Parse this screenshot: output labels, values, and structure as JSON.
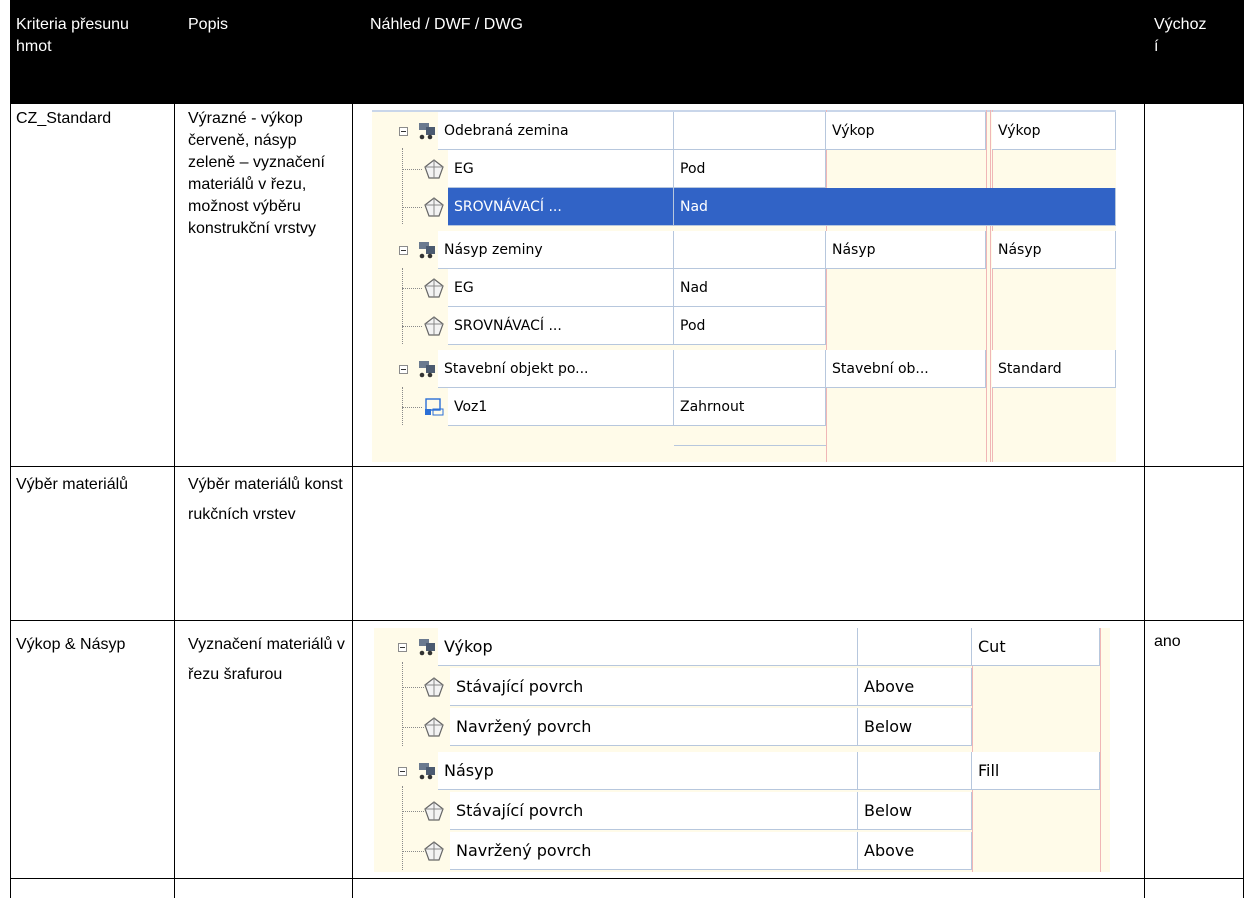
{
  "table": {
    "headers": {
      "criteria": "Kriteria přesunu hmot",
      "description": "Popis",
      "preview": "Náhled / DWF / DWG",
      "default": "Výchozí"
    },
    "rows": [
      {
        "criteria": "CZ_Standard",
        "description": "Výrazné - výkop červeně, násyp zeleně – vyznačení materiálů v řezu, možnost výběru konstrukční vrstvy",
        "default": ""
      },
      {
        "criteria": "Výběr materiálů",
        "description": "Výběr materiálů konstrukčních vrstev",
        "default": ""
      },
      {
        "criteria": "Výkop & Násyp",
        "description": "Vyznačení materiálů v řezu šrafurou",
        "default": "ano"
      }
    ]
  },
  "preview1": {
    "groups": [
      {
        "name": "Odebraná zemina",
        "col3": "Výkop",
        "col4": "Výkop",
        "children": [
          {
            "name": "EG",
            "col2": "Pod",
            "selected": false
          },
          {
            "name": "SROVNÁVACÍ ...",
            "col2": "Nad",
            "selected": true
          }
        ]
      },
      {
        "name": "Násyp zeminy",
        "col3": "Násyp",
        "col4": "Násyp",
        "children": [
          {
            "name": "EG",
            "col2": "Nad",
            "selected": false
          },
          {
            "name": "SROVNÁVACÍ ...",
            "col2": "Pod",
            "selected": false
          }
        ]
      },
      {
        "name": "Stavební objekt po...",
        "col3": "Stavební ob...",
        "col4": "Standard",
        "children": [
          {
            "name": "Voz1",
            "col2": "Zahrnout",
            "selected": false
          }
        ]
      }
    ]
  },
  "preview2": {
    "groups": [
      {
        "name": "Výkop",
        "col3": "Cut",
        "children": [
          {
            "name": "Stávající povrch",
            "col2": "Above"
          },
          {
            "name": "Navržený povrch",
            "col2": "Below"
          }
        ]
      },
      {
        "name": "Násyp",
        "col3": "Fill",
        "children": [
          {
            "name": "Stávající povrch",
            "col2": "Below"
          },
          {
            "name": "Navržený povrch",
            "col2": "Above"
          }
        ]
      }
    ]
  },
  "icons": {
    "expander": "collapse-minus-icon",
    "group": "earthwork-group-icon",
    "surface": "surface-icon",
    "corridor": "corridor-region-icon"
  },
  "colors": {
    "header_bg": "#000000",
    "grid_bg": "#fffbe9",
    "selection": "#3163c6"
  }
}
